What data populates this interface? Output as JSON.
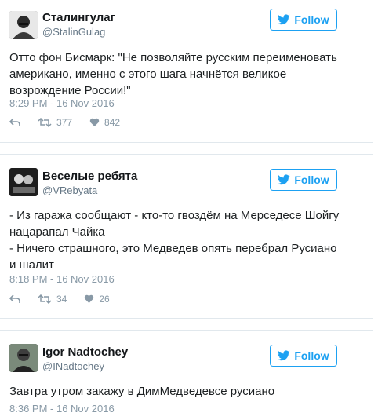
{
  "follow_label": "Follow",
  "tweets": [
    {
      "name": "Сталингулаг",
      "handle": "@StalinGulag",
      "text": "Отто фон Бисмарк: \"Не позволяйте русским переименовать\nамерикано, именно с этого шага начнётся великое\nвозрождение России!\"",
      "time": "8:29 PM - 16 Nov 2016",
      "retweets": "377",
      "likes": "842"
    },
    {
      "name": "Веселые ребята",
      "handle": "@VRebyata",
      "text": "- Из гаража сообщают - кто-то гвоздём на Мерседесе Шойгу\nнацарапал Чайка\n- Ничего страшного, это Медведев опять перебрал Русиано\nи шалит",
      "time": "8:18 PM - 16 Nov 2016",
      "retweets": "34",
      "likes": "26"
    },
    {
      "name": "Igor Nadtochey",
      "handle": "@INadtochey",
      "text": "Завтра утром закажу в ДимМедведевсе русиано",
      "time": "8:36 PM - 16 Nov 2016"
    }
  ],
  "colors": {
    "accent": "#1da1f2",
    "muted": "#8899a6",
    "border": "#e1e8ed"
  }
}
